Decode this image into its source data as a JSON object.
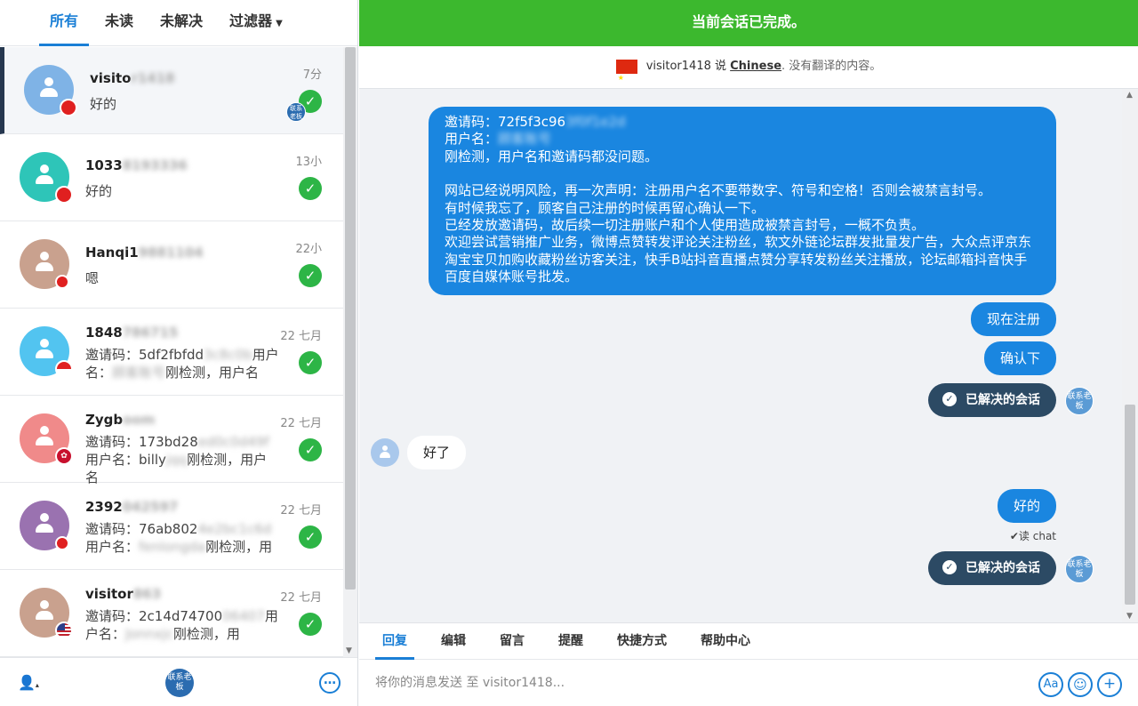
{
  "left_tabs": {
    "all": "所有",
    "unread": "未读",
    "unresolved": "未解决",
    "filter": "过滤器"
  },
  "conversations": [
    {
      "name_visible": "visito",
      "name_blurred": "r1418",
      "snippet": "好的",
      "time": "7分",
      "avatar_color": "#7fb3e6",
      "flag": "cn",
      "badge": "联系老板"
    },
    {
      "name_visible": "1033",
      "name_blurred": "8193336",
      "snippet": "好的",
      "time": "13小",
      "avatar_color": "#2ec5b8",
      "flag": "cn"
    },
    {
      "name_visible": "Hanqi1",
      "name_blurred": "9881104",
      "snippet": "嗯",
      "time": "22小",
      "avatar_color": "#c9a18e",
      "flag": "dot"
    },
    {
      "name_visible": "1848",
      "name_blurred": "786715",
      "snippet_a": "邀请码：5df2fbfdd",
      "snippet_blur": "3c8c0b",
      "snippet_b": "用户名：",
      "snippet_blur2": "顾客账号",
      "snippet_c": "刚检测，用户名",
      "time": "22 七月",
      "avatar_color": "#52c4f0",
      "flag": "hk"
    },
    {
      "name_visible": "Zygb",
      "name_blurred": "oom",
      "snippet_a": "邀请码：173bd28",
      "snippet_blur": "ed0c0d49f",
      "snippet_b": "用户名：billy",
      "snippet_blur2": "jqq",
      "snippet_c": "刚检测，用户名",
      "time": "22 七月",
      "avatar_color": "#f08a8a",
      "flag": "hk2"
    },
    {
      "name_visible": "2392",
      "name_blurred": "042597",
      "snippet_a": "邀请码：76ab802",
      "snippet_blur": "4e2bc1c6d",
      "snippet_b": "用户名：",
      "snippet_blur2": "fenlongda",
      "snippet_c": "刚检测，用",
      "time": "22 七月",
      "avatar_color": "#9a72b0",
      "flag": "dot"
    },
    {
      "name_visible": "visitor",
      "name_blurred": "863",
      "snippet_a": "邀请码：2c14d74700",
      "snippet_blur": "06407",
      "snippet_b": "用户名：",
      "snippet_blur2": "Jonnxjc",
      "snippet_c": "刚检测，用",
      "time": "22 七月",
      "avatar_color": "#c9a18e",
      "flag": "us"
    }
  ],
  "footer": {
    "badge": "联系老板",
    "more": "…"
  },
  "banner": "当前会话已完成。",
  "translate": {
    "visitor": "visitor1418 说",
    "lang": "Chinese",
    "suffix": ". 没有翻译的内容。"
  },
  "messages": {
    "big": {
      "invite_label": "邀请码：72f5f3c96",
      "invite_blur": "3f0f1e2d",
      "user_label": "用户名：",
      "user_blur": "顾客账号",
      "line3": "刚检测，用户名和邀请码都没问题。",
      "line4": "网站已经说明风险，再一次声明：注册用户名不要带数字、符号和空格！否则会被禁言封号。",
      "line5": "有时候我忘了，顾客自己注册的时候再留心确认一下。",
      "line6": "已经发放邀请码，故后续一切注册账户和个人使用造成被禁言封号，一概不负责。",
      "line7": "欢迎尝试营销推广业务，微博点赞转发评论关注粉丝，软文外链论坛群发批量发广告，大众点评京东淘宝宝贝加购收藏粉丝访客关注，快手B站抖音直播点赞分享转发粉丝关注播放，论坛邮箱抖音快手百度自媒体账号批发。"
    },
    "register_now": "现在注册",
    "confirm": "确认下",
    "resolved": "已解决的会话",
    "agent_badge": "联系老板",
    "visitor_reply": "好了",
    "ok": "好的",
    "read_receipt": "读 chat"
  },
  "composer": {
    "tabs": [
      "回复",
      "编辑",
      "留言",
      "提醒",
      "快捷方式",
      "帮助中心"
    ],
    "placeholder": "将你的消息发送 至 visitor1418..."
  },
  "colors": {
    "accent": "#1a7fd6",
    "banner": "#3cb82e",
    "resolved": "#2c4a64",
    "check": "#2db546"
  }
}
